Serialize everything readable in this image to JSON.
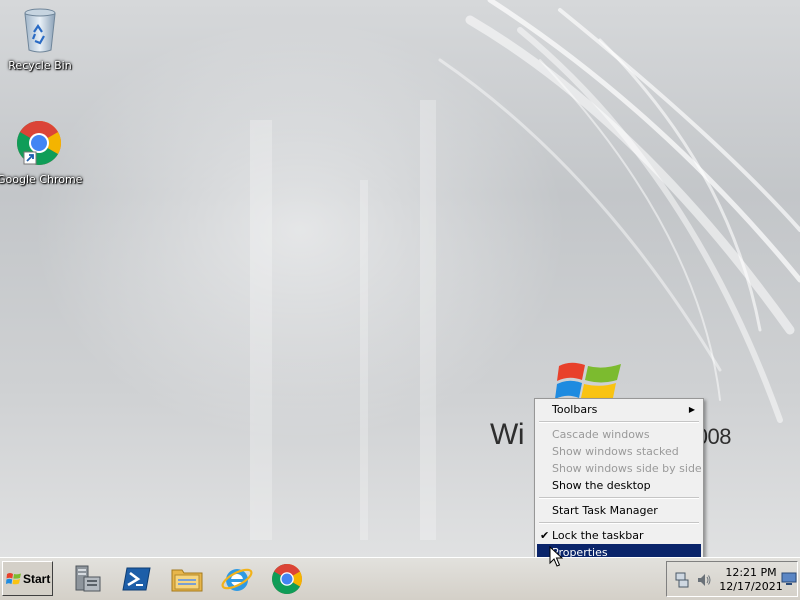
{
  "desktop": {
    "icons": [
      {
        "label": "Recycle Bin",
        "icon": "recycle-bin-icon"
      },
      {
        "label": "Google Chrome",
        "icon": "chrome-icon"
      }
    ],
    "wallpaper_brand_left": "Wi",
    "wallpaper_brand_right": "2008"
  },
  "context_menu": {
    "items": [
      {
        "label": "Toolbars",
        "enabled": true,
        "submenu": true
      },
      {
        "label": "Cascade windows",
        "enabled": false
      },
      {
        "label": "Show windows stacked",
        "enabled": false
      },
      {
        "label": "Show windows side by side",
        "enabled": false
      },
      {
        "label": "Show the desktop",
        "enabled": true
      },
      {
        "label": "Start Task Manager",
        "enabled": true
      },
      {
        "label": "Lock the taskbar",
        "enabled": true,
        "checked": true
      },
      {
        "label": "Properties",
        "enabled": true,
        "highlighted": true
      }
    ]
  },
  "taskbar": {
    "start_label": "Start",
    "pinned": [
      "server-manager-icon",
      "powershell-icon",
      "file-explorer-icon",
      "internet-explorer-icon",
      "chrome-icon"
    ],
    "tray": {
      "time": "12:21 PM",
      "date": "12/17/2021",
      "icons": [
        "network-icon",
        "volume-icon",
        "show-desktop-icon"
      ]
    }
  },
  "colors": {
    "menu_highlight": "#0a246a",
    "taskbar": "#d4d0c8"
  }
}
